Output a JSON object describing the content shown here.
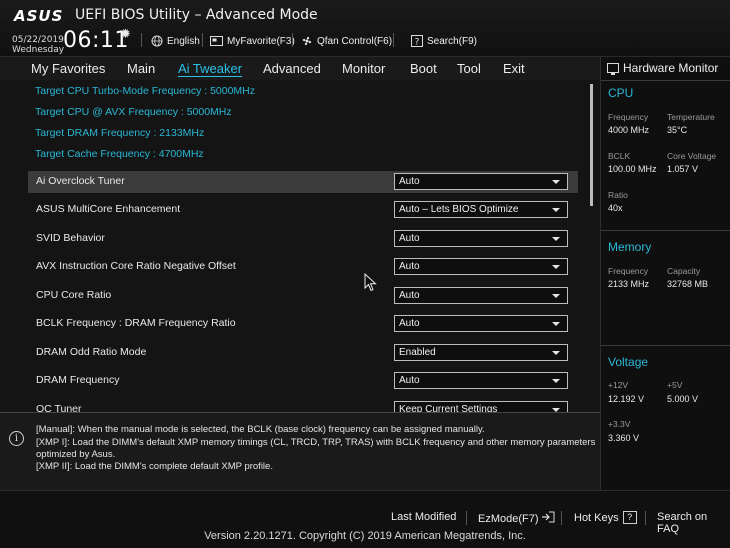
{
  "header": {
    "logo": "ASUS",
    "title": "UEFI BIOS Utility – Advanced Mode",
    "date": "05/22/2019",
    "weekday": "Wednesday",
    "time": "06:11",
    "buttons": {
      "language": "English",
      "myfavorite": "MyFavorite(F3)",
      "qfan": "Qfan Control(F6)",
      "search": "Search(F9)"
    }
  },
  "nav": {
    "tabs": [
      "My Favorites",
      "Main",
      "Ai Tweaker",
      "Advanced",
      "Monitor",
      "Boot",
      "Tool",
      "Exit"
    ],
    "active": "Ai Tweaker"
  },
  "main": {
    "info_lines": [
      "Target CPU Turbo-Mode Frequency : 5000MHz",
      "Target CPU @ AVX Frequency : 5000MHz",
      "Target DRAM Frequency : 2133MHz",
      "Target Cache Frequency : 4700MHz"
    ],
    "settings": [
      {
        "label": "Ai Overclock Tuner",
        "value": "Auto"
      },
      {
        "label": "ASUS MultiCore Enhancement",
        "value": "Auto – Lets BIOS Optimize"
      },
      {
        "label": "SVID Behavior",
        "value": "Auto"
      },
      {
        "label": "AVX Instruction Core Ratio Negative Offset",
        "value": "Auto"
      },
      {
        "label": "CPU Core Ratio",
        "value": "Auto"
      },
      {
        "label": "BCLK Frequency : DRAM Frequency Ratio",
        "value": "Auto"
      },
      {
        "label": "DRAM Odd Ratio Mode",
        "value": "Enabled"
      },
      {
        "label": "DRAM Frequency",
        "value": "Auto"
      },
      {
        "label": "OC Tuner",
        "value": "Keep Current Settings"
      }
    ]
  },
  "description": {
    "lines": [
      "[Manual]: When the manual mode is selected, the BCLK (base clock) frequency can be assigned manually.",
      "[XMP I]:  Load the DIMM's default XMP memory timings (CL, TRCD, TRP, TRAS) with BCLK frequency and other memory parameters",
      "optimized by Asus.",
      "[XMP II]:  Load the DIMM's complete default XMP profile."
    ]
  },
  "hw_monitor": {
    "title": "Hardware Monitor",
    "cpu": {
      "section": "CPU",
      "frequency_label": "Frequency",
      "frequency": "4000 MHz",
      "temperature_label": "Temperature",
      "temperature": "35°C",
      "bclk_label": "BCLK",
      "bclk": "100.00 MHz",
      "core_voltage_label": "Core Voltage",
      "core_voltage": "1.057 V",
      "ratio_label": "Ratio",
      "ratio": "40x"
    },
    "memory": {
      "section": "Memory",
      "frequency_label": "Frequency",
      "frequency": "2133 MHz",
      "capacity_label": "Capacity",
      "capacity": "32768 MB"
    },
    "voltage": {
      "section": "Voltage",
      "v12_label": "+12V",
      "v12": "12.192 V",
      "v5_label": "+5V",
      "v5": "5.000 V",
      "v33_label": "+3.3V",
      "v33": "3.360 V"
    }
  },
  "footer": {
    "last_modified": "Last Modified",
    "ezmode": "EzMode(F7)",
    "hot_keys": "Hot Keys",
    "hot_keys_key": "?",
    "search_faq": "Search on FAQ",
    "copyright": "Version 2.20.1271. Copyright (C) 2019 American Megatrends, Inc."
  },
  "colors": {
    "accent": "#2ab8d6",
    "background": "#141414"
  }
}
